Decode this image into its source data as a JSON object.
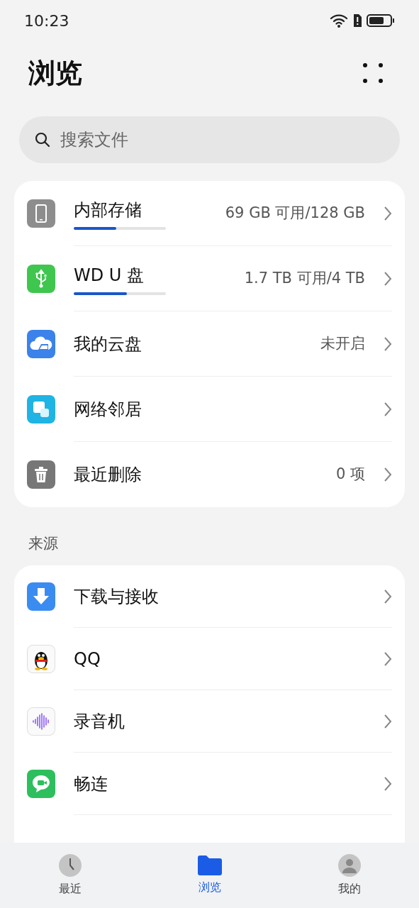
{
  "status_bar": {
    "time": "10:23"
  },
  "header": {
    "title": "浏览"
  },
  "search": {
    "placeholder": "搜索文件"
  },
  "locations": [
    {
      "kind": "storage",
      "label": "内部存储",
      "level": 0.46,
      "detail": "69 GB 可用/128 GB"
    },
    {
      "kind": "storage",
      "label": "WD U 盘",
      "level": 0.58,
      "detail": "1.7 TB 可用/4 TB"
    },
    {
      "kind": "plain",
      "label": "我的云盘",
      "detail": "未开启"
    },
    {
      "kind": "plain",
      "label": "网络邻居"
    },
    {
      "kind": "plain",
      "label": "最近删除",
      "detail": "0 项"
    }
  ],
  "sources_heading": "来源",
  "sources": [
    {
      "label": "下载与接收"
    },
    {
      "label": "QQ"
    },
    {
      "label": "录音机"
    },
    {
      "label": "畅连"
    }
  ],
  "tabs": [
    {
      "label": "最近",
      "selected": false
    },
    {
      "label": "浏览",
      "selected": true
    },
    {
      "label": "我的",
      "selected": false
    }
  ]
}
